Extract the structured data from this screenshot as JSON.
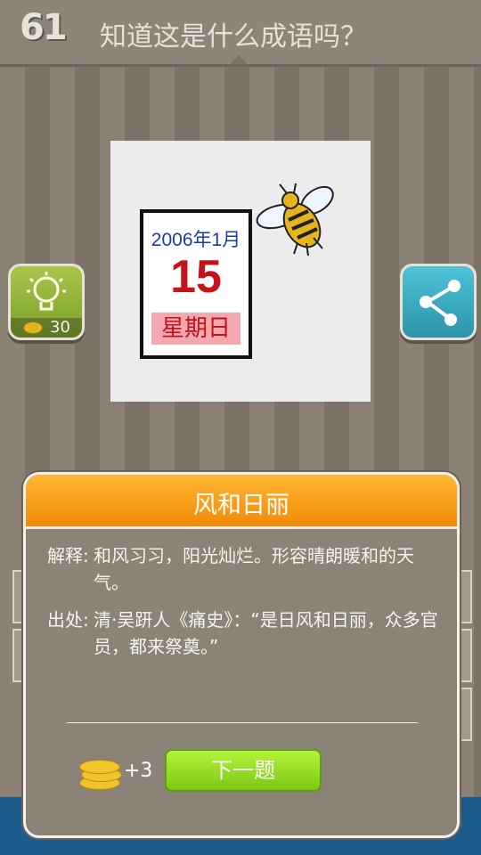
{
  "header": {
    "level": "61",
    "question": "知道这是什么成语吗？"
  },
  "puzzle": {
    "calendar_date": "2006年1月",
    "calendar_day": "15",
    "calendar_weekday": "星期日",
    "bee_icon": "bee-icon"
  },
  "hint_button": {
    "icon": "lightbulb-icon",
    "cost": "30"
  },
  "share_button": {
    "icon": "share-icon"
  },
  "result_dialog": {
    "answer": "风和日丽",
    "explanation_label": "解释:",
    "explanation": "和风习习，阳光灿烂。形容晴朗暖和的天气。",
    "source_label": "出处:",
    "source": "清·吴趼人《痛史》：“是日风和日丽，众多官员，都来祭奠。”",
    "reward": "+3",
    "next_label": "下一题"
  },
  "colors": {
    "dialog_header": "#f5a01a",
    "next_button": "#99e026",
    "background": "#857c71"
  }
}
